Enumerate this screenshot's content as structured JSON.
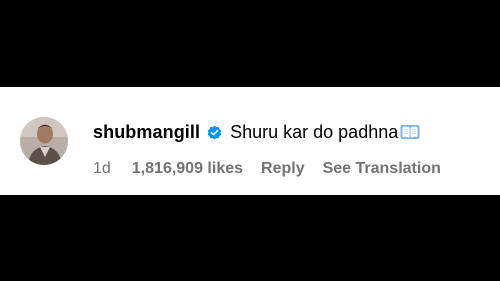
{
  "comment": {
    "username": "shubmangill",
    "text": "Shuru kar do padhna",
    "time": "1d",
    "likes": "1,816,909 likes",
    "reply_label": "Reply",
    "translation_label": "See Translation"
  },
  "icons": {
    "avatar": "profile-photo",
    "verified": "verified-badge-icon",
    "emoji": "open-book-icon"
  },
  "colors": {
    "verified": "#0095f6",
    "meta_text": "#737373"
  }
}
